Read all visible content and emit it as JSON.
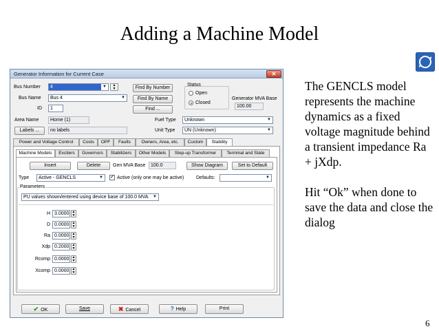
{
  "slide": {
    "title": "Adding a Machine Model",
    "body": [
      "The GENCLS model represents the machine dynamics as a fixed voltage magnitude behind a transient impedance Ra + jXdp.",
      "Hit “Ok” when done to save the data and close the dialog"
    ],
    "page_number": "6",
    "corner_icon": "circular-arrows-icon"
  },
  "dialog": {
    "title": "Generator Information for Current Case",
    "close_glyph": "✕",
    "bus_number_label": "Bus Number",
    "bus_number_value": "4",
    "bus_name_label": "Bus Name",
    "bus_name_value": "Bus 4",
    "id_label": "ID",
    "id_value": "1",
    "area_name_label": "Area Name",
    "area_name_value": "Home (1)",
    "labels_button": "Labels ...",
    "labels_value": "no labels",
    "find_by_number": "Find By Number",
    "find_by_name": "Find By Name",
    "find": "Find ...",
    "status_label": "Status",
    "status_open": "Open",
    "status_closed": "Closed",
    "mva_base_label": "Generator MVA Base",
    "mva_base_value": "100.00",
    "fuel_type_label": "Fuel Type",
    "fuel_type_value": "Unknown",
    "unit_type_label": "Unit Type",
    "unit_type_value": "UN (Unknown)",
    "main_tabs": [
      "Power and Voltage Control",
      "Costs",
      "OPF",
      "Faults",
      "Owners, Area, etc.",
      "Custom",
      "Stability"
    ],
    "sub_tabs": [
      "Machine Models",
      "Exciters",
      "Governors",
      "Stabilizers",
      "Other Models",
      "Step-up Transformer",
      "Terminal and State"
    ],
    "insert": "Insert",
    "delete": "Delete",
    "gen_mva_base_label": "Gen MVA Base",
    "gen_mva_base_value": "100.0",
    "show_diagram": "Show Diagram",
    "set_to_default": "Set to Default",
    "type_label": "Type",
    "type_value": "Active - GENCLS",
    "active_check_label": "Active (only one may be active)",
    "defaults_label": "Defaults:",
    "parameters_label": "Parameters",
    "pu_values_value": "PU values shown/entered using device base of 100.0 MVA",
    "params": [
      {
        "name": "H",
        "value": "3.0000"
      },
      {
        "name": "D",
        "value": "0.0000"
      },
      {
        "name": "Ra",
        "value": "0.0000"
      },
      {
        "name": "Xdp",
        "value": "0.2000"
      },
      {
        "name": "Rcomp",
        "value": "0.0000"
      },
      {
        "name": "Xcomp",
        "value": "0.0000"
      }
    ],
    "ok": "OK",
    "save": "Save",
    "cancel": "Cancel",
    "help": "Help",
    "print": "Print"
  }
}
